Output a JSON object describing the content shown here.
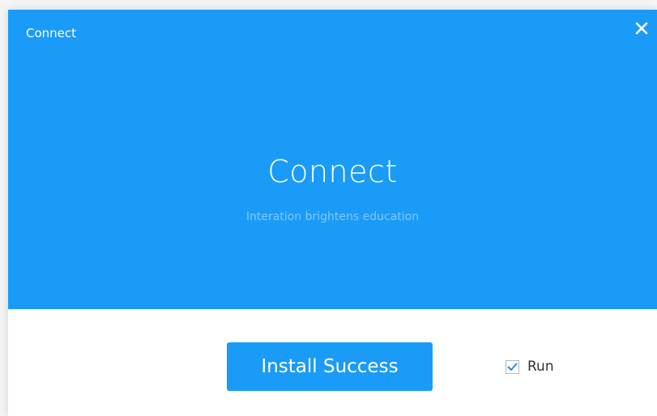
{
  "window": {
    "title": "Connect"
  },
  "hero": {
    "app_name": "Connect",
    "tagline": "Interation brightens education"
  },
  "actions": {
    "install_button_label": "Install Success",
    "run_checkbox": {
      "label": "Run",
      "checked": true
    }
  },
  "icons": {
    "close": "close-icon",
    "check": "checkmark-icon"
  },
  "colors": {
    "brand_blue": "#1a9bf7",
    "background": "#ffffff",
    "text_dark": "#333333"
  }
}
